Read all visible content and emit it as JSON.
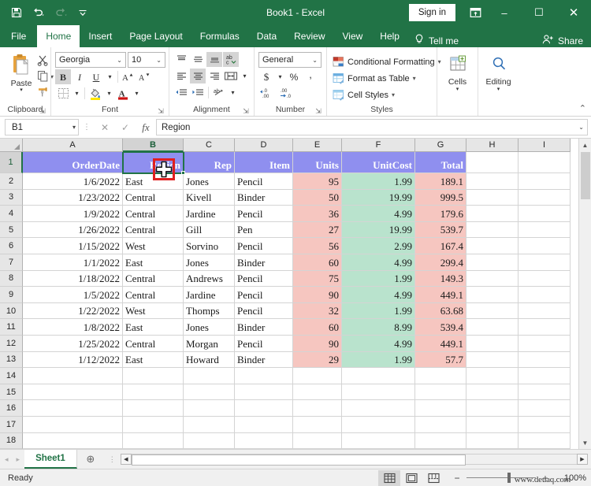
{
  "titlebar": {
    "document_title": "Book1  -  Excel",
    "signin_label": "Sign in",
    "qat": [
      {
        "name": "save-icon",
        "label": "Save"
      },
      {
        "name": "undo-icon",
        "label": "Undo"
      },
      {
        "name": "redo-icon",
        "label": "Redo"
      },
      {
        "name": "customize-qat-icon",
        "label": "Customize Quick Access Toolbar"
      }
    ],
    "ribbon_display_options": "Ribbon Display Options",
    "minimize": "–",
    "maximize": "☐",
    "close": "✕"
  },
  "tabs": {
    "items": [
      {
        "label": "File",
        "active": false
      },
      {
        "label": "Home",
        "active": true
      },
      {
        "label": "Insert",
        "active": false
      },
      {
        "label": "Page Layout",
        "active": false
      },
      {
        "label": "Formulas",
        "active": false
      },
      {
        "label": "Data",
        "active": false
      },
      {
        "label": "Review",
        "active": false
      },
      {
        "label": "View",
        "active": false
      },
      {
        "label": "Help",
        "active": false
      }
    ],
    "tell_me": "Tell me",
    "share": "Share"
  },
  "ribbon": {
    "clipboard": {
      "group_label": "Clipboard",
      "paste_label": "Paste",
      "cut_label": "Cut",
      "copy_label": "Copy",
      "format_painter_label": "Format Painter"
    },
    "font": {
      "group_label": "Font",
      "font_name": "Georgia",
      "font_size": "10",
      "bold": "B",
      "italic": "I",
      "underline": "U",
      "increase_size": "A",
      "decrease_size": "A",
      "borders_label": "Borders",
      "fill_color_label": "Fill Color",
      "font_color_label": "Font Color"
    },
    "alignment": {
      "group_label": "Alignment",
      "top_align": "Top Align",
      "middle_align": "Middle Align",
      "bottom_align": "Bottom Align",
      "orientation": "Orientation",
      "align_left": "Align Left",
      "center": "Center",
      "align_right": "Align Right",
      "wrap_text": "Wrap Text",
      "decrease_indent": "Decrease Indent",
      "increase_indent": "Increase Indent",
      "merge_center": "Merge & Center"
    },
    "number": {
      "group_label": "Number",
      "format": "General",
      "accounting": "$",
      "percent": "%",
      "comma": ",",
      "increase_decimal": "Increase Decimal",
      "decrease_decimal": "Decrease Decimal"
    },
    "styles": {
      "group_label": "Styles",
      "items": [
        {
          "label": "Conditional Formatting"
        },
        {
          "label": "Format as Table"
        },
        {
          "label": "Cell Styles"
        }
      ]
    },
    "cells": {
      "group_label": "Cells"
    },
    "editing": {
      "group_label": "Editing"
    }
  },
  "formula_bar": {
    "name_box": "B1",
    "cancel": "✕",
    "enter": "✓",
    "insert_function": "fx",
    "formula_value": "Region"
  },
  "grid": {
    "columns": [
      {
        "letter": "A",
        "width": 127,
        "selected": false
      },
      {
        "letter": "B",
        "width": 77,
        "selected": true
      },
      {
        "letter": "C",
        "width": 65,
        "selected": false
      },
      {
        "letter": "D",
        "width": 74,
        "selected": false
      },
      {
        "letter": "E",
        "width": 62,
        "selected": false
      },
      {
        "letter": "F",
        "width": 93,
        "selected": false
      },
      {
        "letter": "G",
        "width": 65,
        "selected": false
      },
      {
        "letter": "H",
        "width": 66,
        "selected": false
      },
      {
        "letter": "I",
        "width": 66,
        "selected": false
      }
    ],
    "row_numbers": [
      "1",
      "2",
      "3",
      "4",
      "5",
      "6",
      "7",
      "8",
      "9",
      "10",
      "11",
      "12",
      "13",
      "14",
      "15",
      "16",
      "17",
      "18"
    ],
    "header_row": [
      "OrderDate",
      "Region",
      "Rep",
      "Item",
      "Units",
      "UnitCost",
      "Total"
    ],
    "rows": [
      {
        "OrderDate": "1/6/2022",
        "Region": "East",
        "Rep": "Jones",
        "Item": "Pencil",
        "Units": "95",
        "UnitCost": "1.99",
        "Total": "189.1"
      },
      {
        "OrderDate": "1/23/2022",
        "Region": "Central",
        "Rep": "Kivell",
        "Item": "Binder",
        "Units": "50",
        "UnitCost": "19.99",
        "Total": "999.5"
      },
      {
        "OrderDate": "1/9/2022",
        "Region": "Central",
        "Rep": "Jardine",
        "Item": "Pencil",
        "Units": "36",
        "UnitCost": "4.99",
        "Total": "179.6"
      },
      {
        "OrderDate": "1/26/2022",
        "Region": "Central",
        "Rep": "Gill",
        "Item": "Pen",
        "Units": "27",
        "UnitCost": "19.99",
        "Total": "539.7"
      },
      {
        "OrderDate": "1/15/2022",
        "Region": "West",
        "Rep": "Sorvino",
        "Item": "Pencil",
        "Units": "56",
        "UnitCost": "2.99",
        "Total": "167.4"
      },
      {
        "OrderDate": "1/1/2022",
        "Region": "East",
        "Rep": "Jones",
        "Item": "Binder",
        "Units": "60",
        "UnitCost": "4.99",
        "Total": "299.4"
      },
      {
        "OrderDate": "1/18/2022",
        "Region": "Central",
        "Rep": "Andrews",
        "Item": "Pencil",
        "Units": "75",
        "UnitCost": "1.99",
        "Total": "149.3"
      },
      {
        "OrderDate": "1/5/2022",
        "Region": "Central",
        "Rep": "Jardine",
        "Item": "Pencil",
        "Units": "90",
        "UnitCost": "4.99",
        "Total": "449.1"
      },
      {
        "OrderDate": "1/22/2022",
        "Region": "West",
        "Rep": "Thomps",
        "Item": "Pencil",
        "Units": "32",
        "UnitCost": "1.99",
        "Total": "63.68"
      },
      {
        "OrderDate": "1/8/2022",
        "Region": "East",
        "Rep": "Jones",
        "Item": "Binder",
        "Units": "60",
        "UnitCost": "8.99",
        "Total": "539.4"
      },
      {
        "OrderDate": "1/25/2022",
        "Region": "Central",
        "Rep": "Morgan",
        "Item": "Pencil",
        "Units": "90",
        "UnitCost": "4.99",
        "Total": "449.1"
      },
      {
        "OrderDate": "1/12/2022",
        "Region": "East",
        "Rep": "Howard",
        "Item": "Binder",
        "Units": "29",
        "UnitCost": "1.99",
        "Total": "57.7"
      }
    ],
    "selected_cell": "B1",
    "cursor_icon": "move-cross-cursor"
  },
  "colors": {
    "excel_green": "#217346",
    "header_fill": "#8f8fef",
    "header_text": "#ffffff",
    "units_fill": "#f6c6c0",
    "unitcost_fill": "#b9e3cd",
    "total_fill": "#f6c6c0",
    "annotation_red": "#e02020"
  },
  "sheet_tabs": {
    "prev": "◂",
    "next": "▸",
    "tabs": [
      {
        "label": "Sheet1",
        "active": true
      }
    ],
    "add_sheet": "⊕"
  },
  "status_bar": {
    "status": "Ready",
    "views": [
      {
        "name": "normal-view-icon",
        "active": true
      },
      {
        "name": "page-layout-view-icon",
        "active": false
      },
      {
        "name": "page-break-preview-icon",
        "active": false
      }
    ],
    "zoom_out": "−",
    "zoom_in": "+",
    "zoom_level": "100%",
    "watermark": "www.deuaq.com"
  }
}
